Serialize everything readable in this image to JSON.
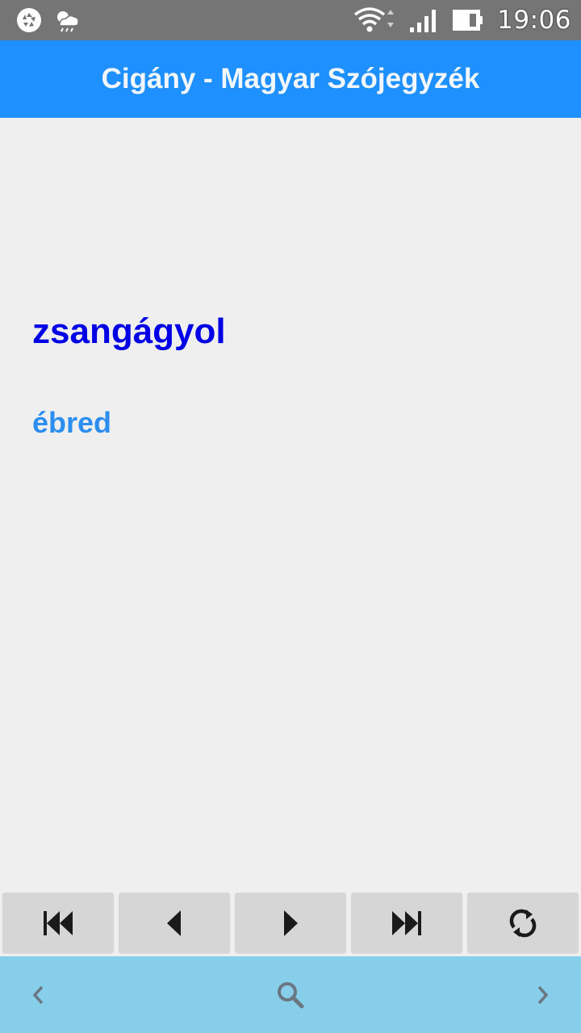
{
  "status_bar": {
    "time": "19:06",
    "icons": [
      "aperture-icon",
      "weather-icon",
      "wifi-icon",
      "signal-icon",
      "battery-icon"
    ]
  },
  "app_bar": {
    "title": "Cigány - Magyar Szójegyzék"
  },
  "entry": {
    "word": "zsangágyol",
    "translation": "ébred"
  },
  "nav_buttons": [
    {
      "icon": "skip-first-icon"
    },
    {
      "icon": "previous-icon"
    },
    {
      "icon": "next-icon"
    },
    {
      "icon": "skip-last-icon"
    },
    {
      "icon": "refresh-icon"
    }
  ],
  "bottom_bar": {
    "icons": [
      "chevron-left-icon",
      "search-icon",
      "chevron-right-icon"
    ]
  },
  "colors": {
    "status_bar": "#757575",
    "app_bar": "#1e90ff",
    "background": "#efefef",
    "word": "#0000e6",
    "translation": "#2b8ef0",
    "button": "#d6d6d6",
    "bottom_bar": "#87ceeb"
  }
}
